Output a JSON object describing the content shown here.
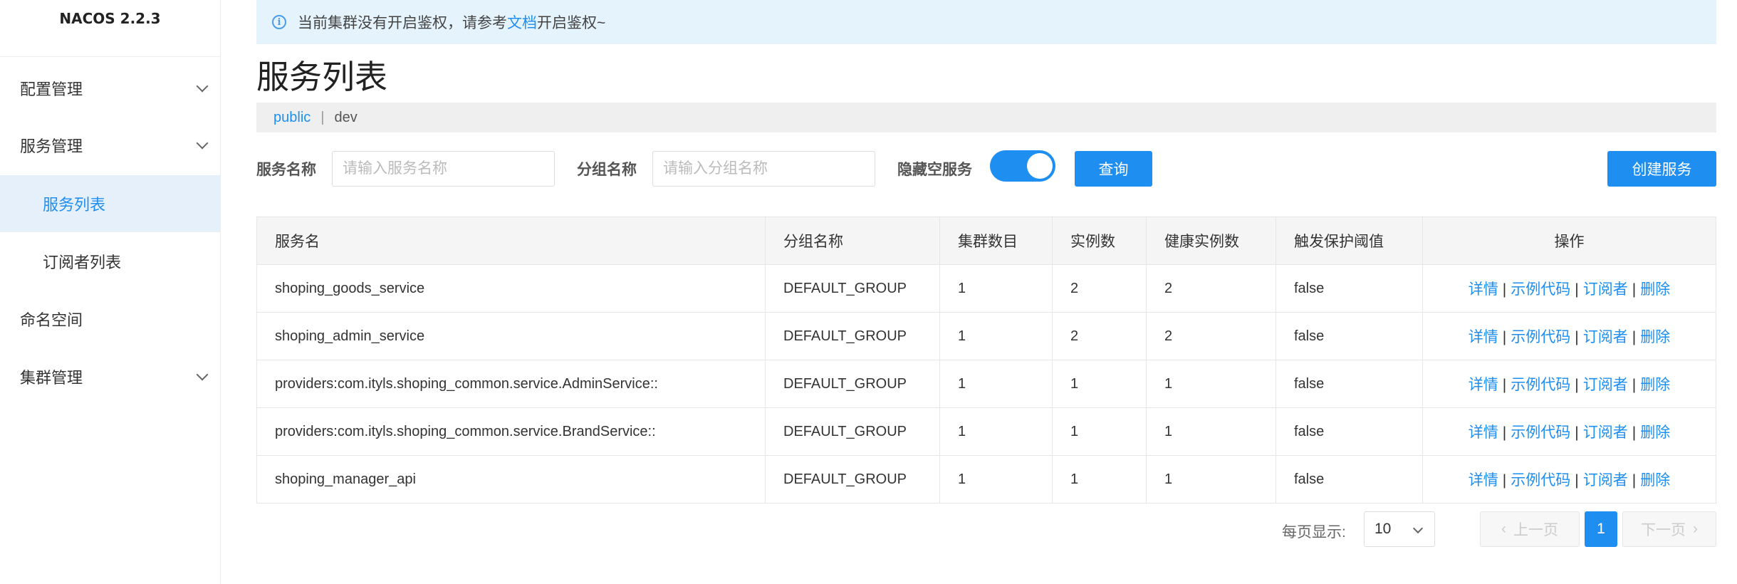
{
  "app": {
    "title": "NACOS 2.2.3"
  },
  "sidebar": {
    "items": [
      {
        "label": "配置管理"
      },
      {
        "label": "服务管理"
      },
      {
        "label": "服务列表"
      },
      {
        "label": "订阅者列表"
      },
      {
        "label": "命名空间"
      },
      {
        "label": "集群管理"
      }
    ]
  },
  "notice": {
    "prefix": "当前集群没有开启鉴权，请参考",
    "link": "文档",
    "suffix": "开启鉴权~"
  },
  "page": {
    "title": "服务列表"
  },
  "namespaces": {
    "public": "public",
    "separator": "|",
    "dev": "dev"
  },
  "filters": {
    "service_name_label": "服务名称",
    "service_name_placeholder": "请输入服务名称",
    "group_name_label": "分组名称",
    "group_name_placeholder": "请输入分组名称",
    "hide_empty_label": "隐藏空服务",
    "hide_empty_on": true,
    "query_button": "查询",
    "create_button": "创建服务"
  },
  "table": {
    "columns": [
      "服务名",
      "分组名称",
      "集群数目",
      "实例数",
      "健康实例数",
      "触发保护阈值",
      "操作"
    ],
    "rows": [
      [
        "shoping_goods_service",
        "DEFAULT_GROUP",
        "1",
        "2",
        "2",
        "false"
      ],
      [
        "shoping_admin_service",
        "DEFAULT_GROUP",
        "1",
        "2",
        "2",
        "false"
      ],
      [
        "providers:com.ityls.shoping_common.service.AdminService::",
        "DEFAULT_GROUP",
        "1",
        "1",
        "1",
        "false"
      ],
      [
        "providers:com.ityls.shoping_common.service.BrandService::",
        "DEFAULT_GROUP",
        "1",
        "1",
        "1",
        "false"
      ],
      [
        "shoping_manager_api",
        "DEFAULT_GROUP",
        "1",
        "1",
        "1",
        "false"
      ]
    ],
    "actions": {
      "detail": "详情",
      "sample": "示例代码",
      "subscribers": "订阅者",
      "delete": "删除",
      "separator": "|"
    }
  },
  "pagination": {
    "page_size_label": "每页显示:",
    "page_size": "10",
    "prev": "上一页",
    "next": "下一页",
    "current": "1"
  },
  "colors": {
    "accent": "#1f8ef1",
    "notice_bg": "#e5f3fd",
    "active_bg": "#e5f0fa"
  }
}
